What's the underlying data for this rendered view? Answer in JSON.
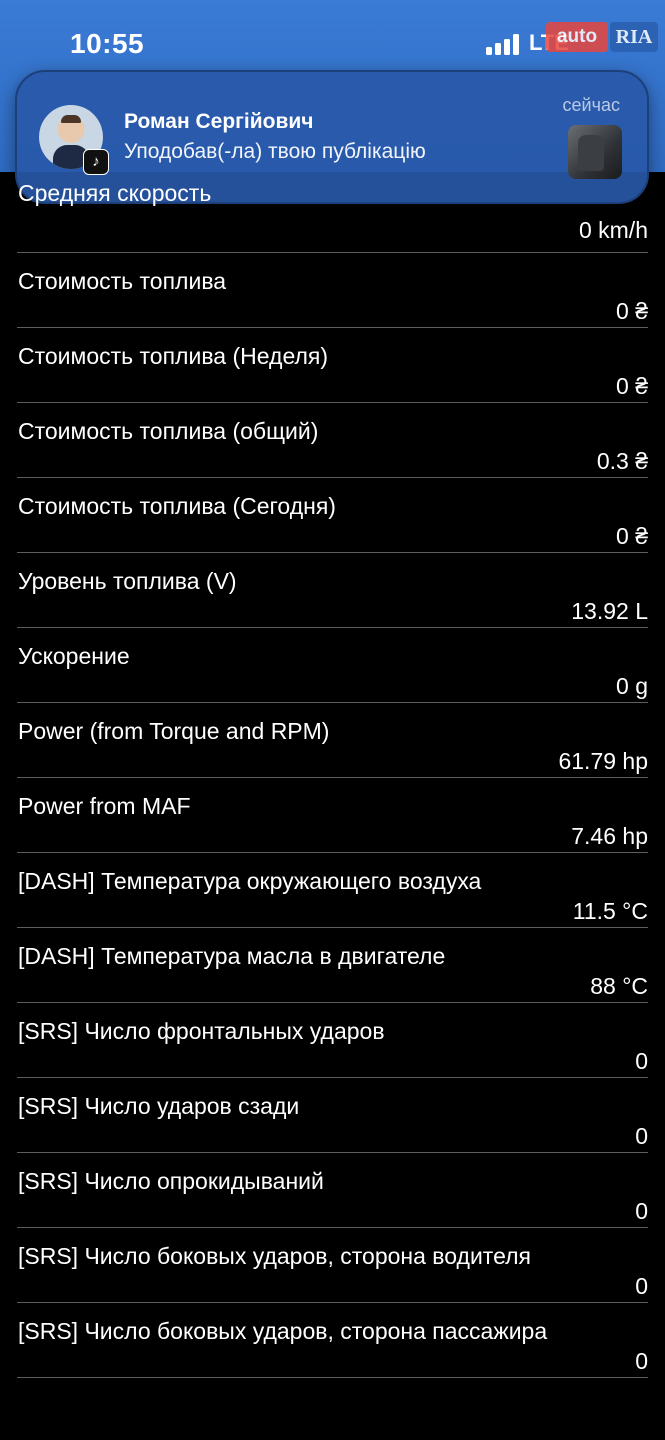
{
  "status_bar": {
    "time": "10:55",
    "network": "LTE"
  },
  "watermark": {
    "auto": "auto",
    "ria": "RIA"
  },
  "notification": {
    "sender": "Роман Сергійович",
    "message": "Уподобав(-ла) твою публікацію",
    "time": "сейчас",
    "app_icon": "tiktok-icon"
  },
  "rows": [
    {
      "label": "Средняя скорость",
      "value": "0 km/h"
    },
    {
      "label": "Стоимость топлива",
      "value": "0 ₴"
    },
    {
      "label": "Стоимость топлива (Неделя)",
      "value": "0 ₴"
    },
    {
      "label": "Стоимость топлива (общий)",
      "value": "0.3 ₴"
    },
    {
      "label": "Стоимость топлива (Сегодня)",
      "value": "0 ₴"
    },
    {
      "label": "Уровень топлива (V)",
      "value": "13.92 L"
    },
    {
      "label": "Ускорение",
      "value": "0 g"
    },
    {
      "label": "Power (from Torque and RPM)",
      "value": "61.79 hp"
    },
    {
      "label": "Power from MAF",
      "value": "7.46 hp"
    },
    {
      "label": "[DASH] Температура окружающего воздуха",
      "value": "11.5 °C"
    },
    {
      "label": "[DASH] Температура масла в двигателе",
      "value": "88 °C"
    },
    {
      "label": "[SRS] Число фронтальных ударов",
      "value": "0"
    },
    {
      "label": "[SRS] Число ударов сзади",
      "value": "0"
    },
    {
      "label": "[SRS] Число опрокидываний",
      "value": "0"
    },
    {
      "label": "[SRS] Число боковых ударов, сторона водителя",
      "value": "0"
    },
    {
      "label": "[SRS] Число боковых ударов, сторона пассажира",
      "value": "0"
    }
  ]
}
